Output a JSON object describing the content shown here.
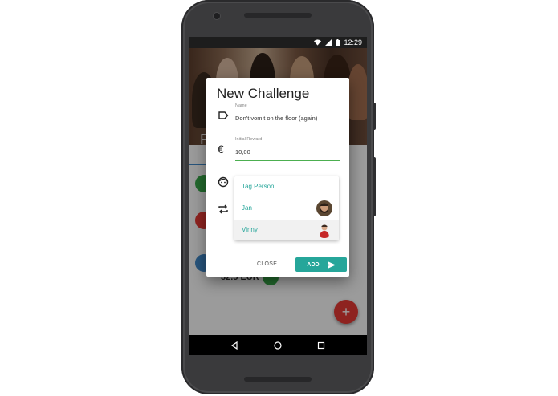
{
  "status_bar": {
    "time": "12:29"
  },
  "background": {
    "hero_title": "F",
    "amount": "32.5 EUR"
  },
  "dialog": {
    "title": "New Challenge",
    "name_field": {
      "label": "Name",
      "value": "Don't vomit on the floor (again)"
    },
    "reward_field": {
      "label": "Initial Reward",
      "value": "10,00"
    },
    "tag_list": {
      "header": "Tag Person",
      "people": [
        {
          "name": "Jan",
          "avatar": "bearded-man-avatar"
        },
        {
          "name": "Vinny",
          "avatar": "man-red-shirt-avatar"
        }
      ]
    },
    "actions": {
      "close_label": "CLOSE",
      "add_label": "ADD"
    }
  },
  "icons": {
    "label": "label-tag-icon",
    "euro": "euro-icon",
    "face": "face-icon",
    "repeat": "repeat-icon",
    "send": "send-icon",
    "back": "nav-back-icon",
    "home": "nav-home-icon",
    "recents": "nav-recents-icon"
  },
  "colors": {
    "accent": "#26a69a",
    "field_underline": "#4caf50",
    "fab": "#e53935",
    "phone_body": "#3a3a3c"
  }
}
